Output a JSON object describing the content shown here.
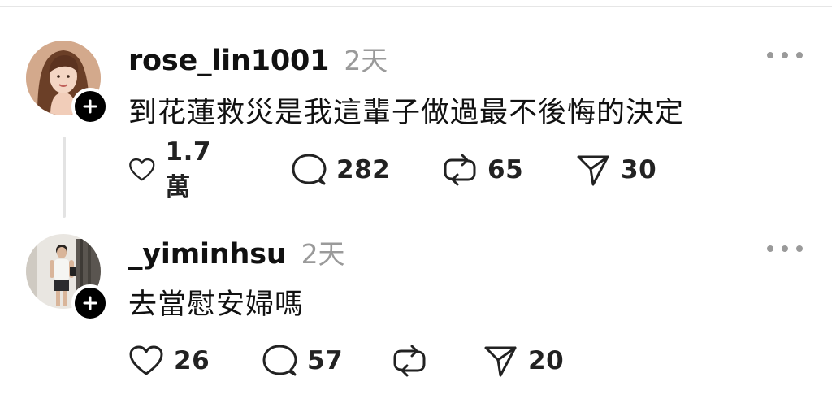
{
  "posts": [
    {
      "username": "rose_lin1001",
      "time": "2天",
      "text": "到花蓮救災是我這輩子做過最不後悔的決定",
      "likes": "1.7萬",
      "replies": "282",
      "reposts": "65",
      "shares": "30"
    },
    {
      "username": "_yiminhsu",
      "time": "2天",
      "text": "去當慰安婦嗎",
      "likes": "26",
      "replies": "57",
      "reposts": "",
      "shares": "20"
    }
  ],
  "icons": {
    "like": "heart-icon",
    "reply": "comment-bubble-icon",
    "repost": "repost-icon",
    "share": "send-icon",
    "follow": "plus-icon",
    "more": "ellipsis-icon"
  }
}
